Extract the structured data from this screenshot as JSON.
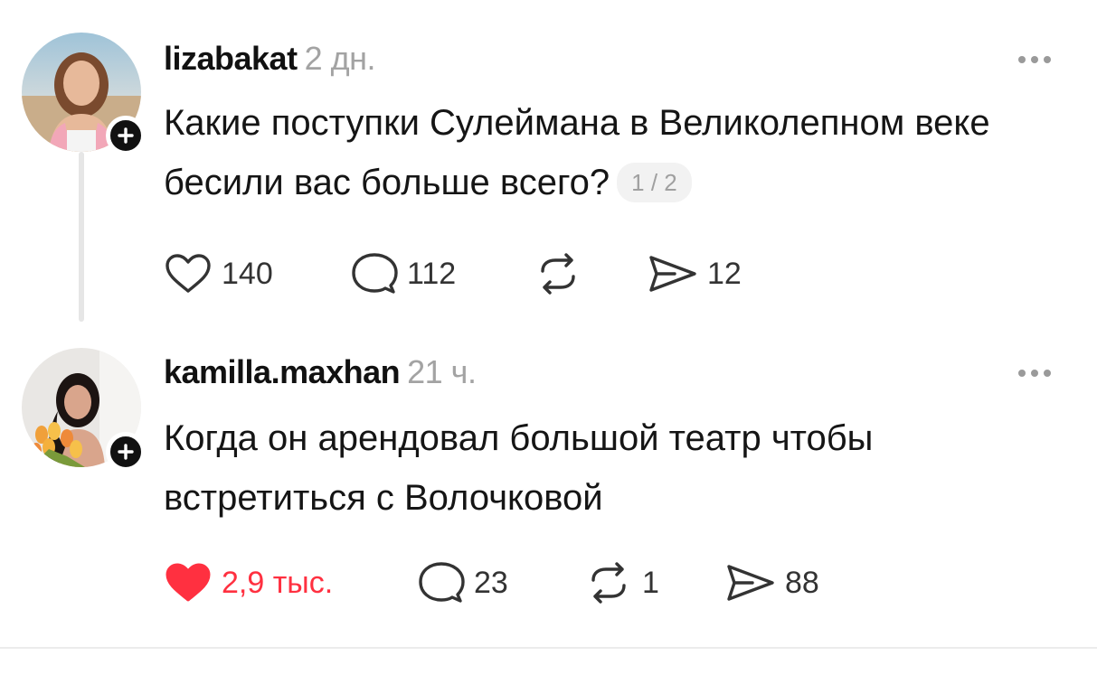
{
  "posts": [
    {
      "username": "lizabakat",
      "time": "2 дн.",
      "text": "Какие поступки Сулеймана в Великолепном веке бесили вас больше всего?",
      "page_indicator": "1 / 2",
      "likes": "140",
      "replies": "112",
      "reposts": "",
      "shares": "12",
      "liked": false,
      "avatar_icon": "user-photo-avatar"
    },
    {
      "username": "kamilla.maxhan",
      "time": "21 ч.",
      "text": "Когда он арендовал большой театр чтобы встретиться с Волочковой",
      "likes": "2,9 тыс.",
      "replies": "23",
      "reposts": "1",
      "shares": "88",
      "liked": true,
      "avatar_icon": "user-photo-avatar"
    }
  ],
  "colors": {
    "like_active": "#ff3040",
    "muted": "#a3a3a3",
    "text": "#111111"
  }
}
